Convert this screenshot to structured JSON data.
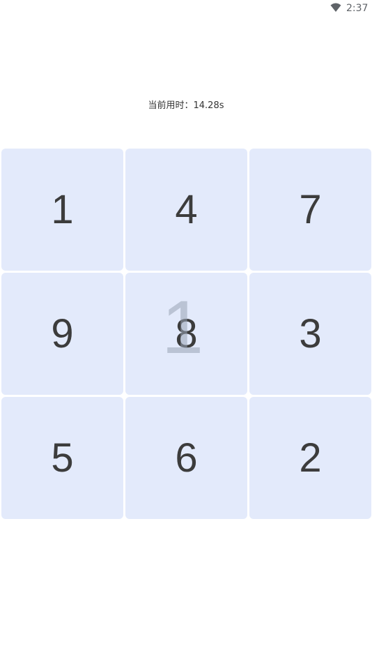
{
  "status_bar": {
    "time": "2:37",
    "wifi_icon": "wifi-icon"
  },
  "timer": {
    "text": "当前用时：14.28s"
  },
  "grid": {
    "tiles": [
      "1",
      "4",
      "7",
      "9",
      "8",
      "3",
      "5",
      "6",
      "2"
    ]
  },
  "ghost": {
    "text": "1"
  },
  "colors": {
    "tile_bg": "#e3eafb",
    "digit": "#3c3c3c",
    "ghost": "#9aa4b6"
  }
}
